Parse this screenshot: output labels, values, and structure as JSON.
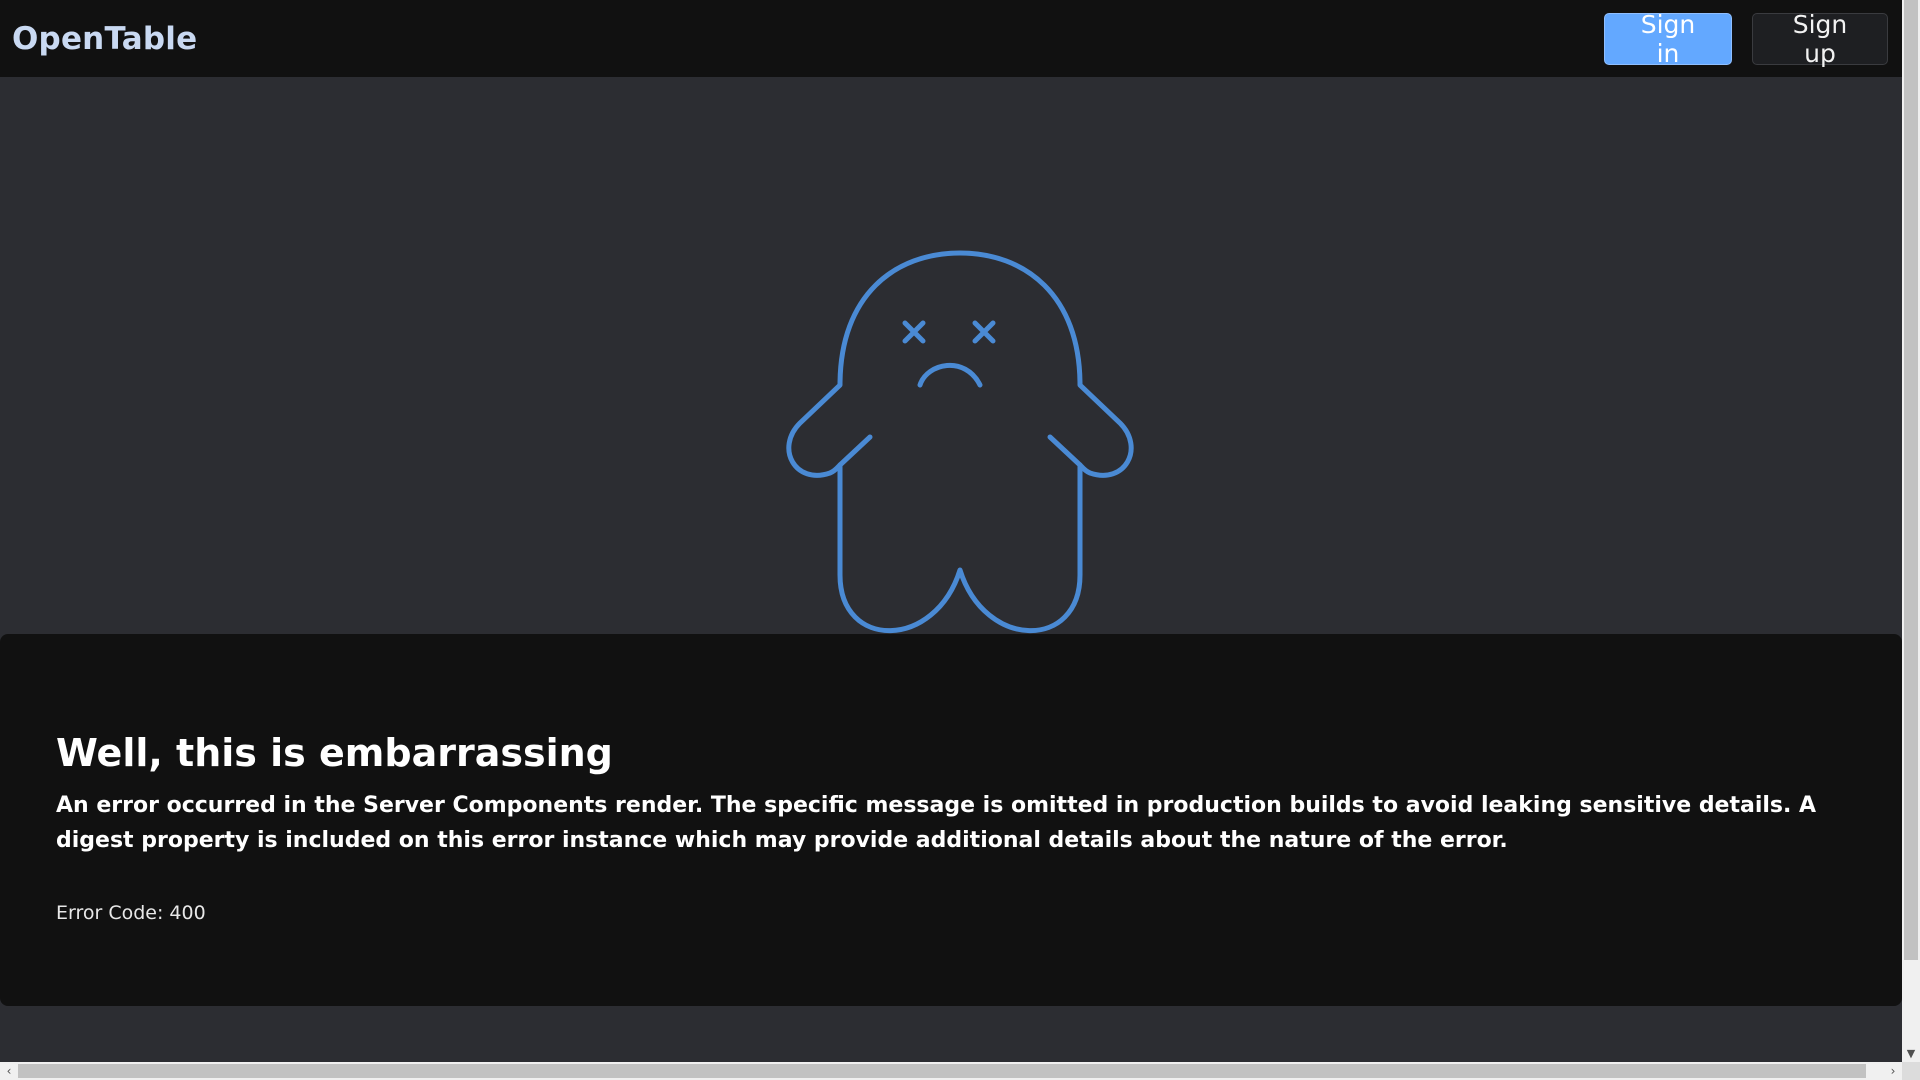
{
  "header": {
    "logo": "OpenTable",
    "sign_in_label": "Sign in",
    "sign_up_label": "Sign up"
  },
  "illustration": {
    "icon": "sad-ghost-icon",
    "stroke_color": "#4a8ad4"
  },
  "error": {
    "title": "Well, this is embarrassing",
    "message": "An error occurred in the Server Components render. The specific message is omitted in production builds to avoid leaking sensitive details. A digest property is included on this error instance which may provide additional details about the nature of the error.",
    "code_text": "Error Code: 400"
  },
  "colors": {
    "header_bg": "#111111",
    "page_bg": "#2c2d32",
    "primary_button": "#63a8ff",
    "logo": "#c9d9f2"
  }
}
